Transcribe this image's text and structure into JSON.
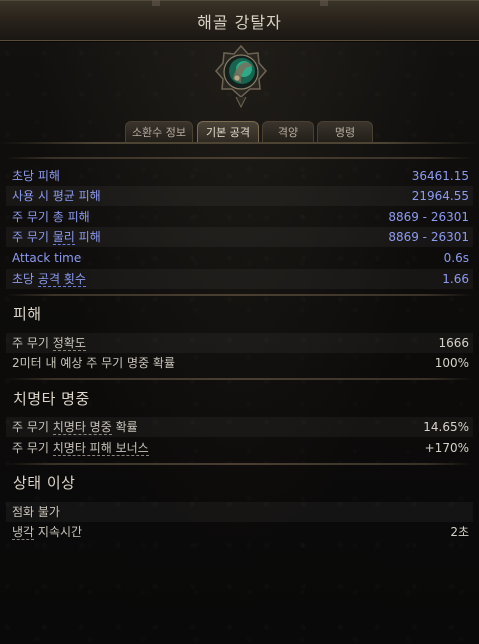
{
  "header": {
    "title": "해골 강탈자"
  },
  "emblem": {
    "icon": "skull-emblem-icon",
    "accent": "#2fd1a0"
  },
  "tabs": [
    {
      "label": "소환수 정보",
      "active": false
    },
    {
      "label": "기본 공격",
      "active": true
    },
    {
      "label": "격양",
      "active": false
    },
    {
      "label": "명령",
      "active": false
    }
  ],
  "basic_attack": {
    "rows": [
      {
        "label_a": "초당 피해",
        "label_u": "",
        "label_b": "",
        "value": "36461.15"
      },
      {
        "label_a": "사용 시 평균 피해",
        "label_u": "",
        "label_b": "",
        "value": "21964.55"
      },
      {
        "label_a": "주 무기 총 피해",
        "label_u": "",
        "label_b": "",
        "value": "8869 - 26301"
      },
      {
        "label_a": "주 무기 ",
        "label_u": "물리",
        "label_b": " 피해",
        "value": "8869 - 26301"
      },
      {
        "label_a": "Attack time",
        "label_u": "",
        "label_b": "",
        "value": "0.6s"
      },
      {
        "label_a": "초당 ",
        "label_u": "공격 횟수",
        "label_b": "",
        "value": "1.66"
      }
    ]
  },
  "damage_section": {
    "title": "피해",
    "rows": [
      {
        "label_a": "주 무기 ",
        "label_u": "정확도",
        "label_b": "",
        "value": "1666"
      },
      {
        "label_a": "2미터 내 예상 주 무기 명중 확률",
        "label_u": "",
        "label_b": "",
        "value": "100%"
      }
    ]
  },
  "crit_section": {
    "title": "치명타 명중",
    "rows": [
      {
        "label_a": "주 무기 ",
        "label_u": "치명타 명중",
        "label_b": " 확률",
        "value": "14.65%"
      },
      {
        "label_a": "주 무기 ",
        "label_u": "치명타 피해 보너스",
        "label_b": "",
        "value": "+170%"
      }
    ]
  },
  "ailment_section": {
    "title": "상태 이상",
    "rows": [
      {
        "label_a": "점화 불가",
        "label_u": "",
        "label_b": "",
        "value": ""
      },
      {
        "label_a": "",
        "label_u": "냉각",
        "label_b": " 지속시간",
        "value": "2초"
      }
    ]
  }
}
